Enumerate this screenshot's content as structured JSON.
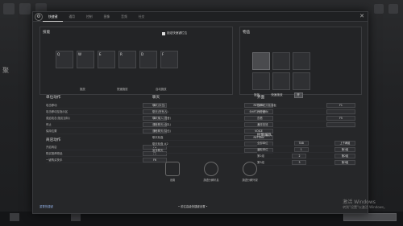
{
  "background": {
    "left_text": "聚"
  },
  "tabs": [
    "快速键",
    "通用",
    "控制",
    "图像",
    "音频",
    "社交"
  ],
  "active_tab": 0,
  "lock_label": "锁定快速键栏位",
  "skills_panel": {
    "title": "技能",
    "slots": [
      "Q",
      "W",
      "E",
      "R",
      "D",
      "F"
    ],
    "labels": [
      "施放",
      "快速施放",
      "自动施放"
    ]
  },
  "items_panel": {
    "title": "物品",
    "labels": [
      "施放",
      "快速施放"
    ],
    "mode": "开"
  },
  "unit_actions": {
    "title": "单位动作",
    "rows": [
      {
        "label": "攻击移动",
        "value": "A"
      },
      {
        "label": "攻击移动至指示区",
        "value": ""
      },
      {
        "label": "强迫攻击(指定目标)",
        "value": "A"
      },
      {
        "label": "停止",
        "value": "S"
      },
      {
        "label": "保持位置",
        "value": "H"
      }
    ]
  },
  "shop_actions": {
    "title": "商店动作",
    "rows": [
      {
        "label": "开启商店",
        "value": "F4"
      },
      {
        "label": "购买推荐物品",
        "value": "F5"
      },
      {
        "label": "一键购买快手",
        "value": "F6"
      }
    ]
  },
  "chat": {
    "title": "聊天",
    "rows": [
      {
        "label": "聊天(队伍)",
        "value": "RETURN"
      },
      {
        "label": "聊天(所有人)",
        "value": "SHIFT-RETURN"
      },
      {
        "label": "聊天输入(语音)",
        "value": ""
      },
      {
        "label": "语音聊天(全队)",
        "value": "N"
      },
      {
        "label": "语音聊天(队伍)",
        "value": "VOICE"
      },
      {
        "label": "聊天轮盘",
        "value": "RETURN"
      },
      {
        "label": "聊天轮盘 #2",
        "value": ""
      },
      {
        "label": "宣传聊天",
        "value": "Y"
      }
    ]
  },
  "interface": {
    "title": "界面",
    "rows": [
      {
        "label": "显示记分板面板",
        "value": "F1"
      },
      {
        "label": "计分板",
        "value": ""
      },
      {
        "label": "查看",
        "value": "F5"
      },
      {
        "label": "选择英雄",
        "value": ""
      }
    ]
  },
  "control_groups": {
    "title": "控制编队",
    "rows": [
      {
        "label": "全部单位",
        "v1": "TAB",
        "v2": "上下两组"
      },
      {
        "label": "选取单位",
        "v1": "1",
        "v2": "第1组"
      },
      {
        "label": "第2组",
        "v1": "2",
        "v2": "第2组"
      },
      {
        "label": "第3组",
        "v1": "3",
        "v2": "第3组"
      }
    ]
  },
  "radial_buttons": [
    "设置",
    "旗语分解讯息",
    "旗语分解外观"
  ],
  "footer": {
    "left_link": "重置快捷键",
    "center": "• 前往高级快捷键设置 •"
  },
  "watermark": {
    "line1": "激活 Windows",
    "line2": "转到\"设置\"以激活 Windows。"
  }
}
